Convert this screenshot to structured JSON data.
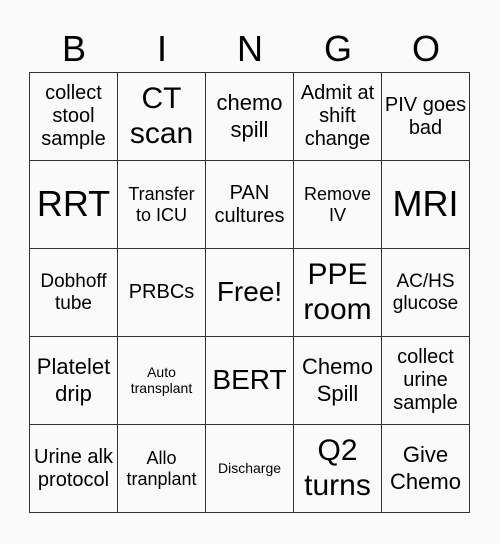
{
  "header": {
    "letters": [
      "B",
      "I",
      "N",
      "G",
      "O"
    ]
  },
  "grid": {
    "rows": [
      [
        "collect stool sample",
        "CT scan",
        "chemo spill",
        "Admit at shift change",
        "PIV goes bad"
      ],
      [
        "RRT",
        "Transfer to ICU",
        "PAN cultures",
        "Remove IV",
        "MRI"
      ],
      [
        "Dobhoff tube",
        "PRBCs",
        "Free!",
        "PPE room",
        "AC/HS glucose"
      ],
      [
        "Platelet drip",
        "Auto transplant",
        "BERT",
        "Chemo Spill",
        "collect urine sample"
      ],
      [
        "Urine alk protocol",
        "Allo tranplant",
        "Discharge",
        "Q2 turns",
        "Give Chemo"
      ]
    ]
  }
}
